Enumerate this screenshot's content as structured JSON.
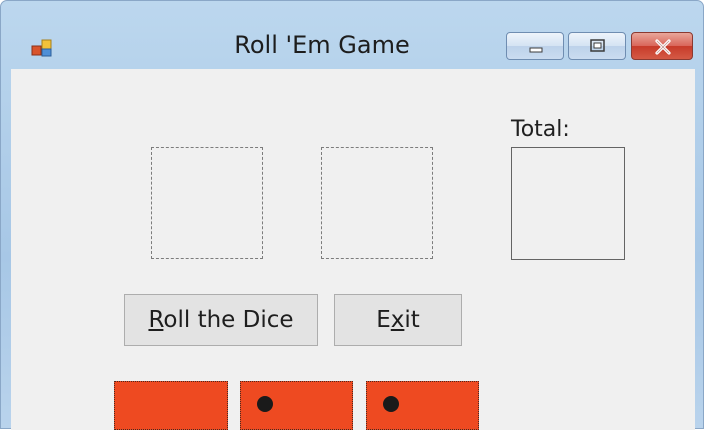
{
  "window": {
    "title": "Roll 'Em Game"
  },
  "icons": {
    "app": "app-icon",
    "minimize": "minimize-icon",
    "maximize": "maximize-icon",
    "close": "close-icon"
  },
  "form": {
    "total_label": "Total:",
    "total_value": "",
    "die1_value": "",
    "die2_value": ""
  },
  "buttons": {
    "roll": {
      "before": "",
      "accel": "R",
      "after": "oll the Dice"
    },
    "exit": {
      "before": "E",
      "accel": "x",
      "after": "it"
    }
  },
  "dice_faces": [
    {
      "pips": 0
    },
    {
      "pips": 1
    },
    {
      "pips": 1
    }
  ],
  "colors": {
    "face": "#ee4a21",
    "client": "#f0f0f0",
    "titlebar": "#bcd7ee",
    "close": "#c73b2a"
  }
}
